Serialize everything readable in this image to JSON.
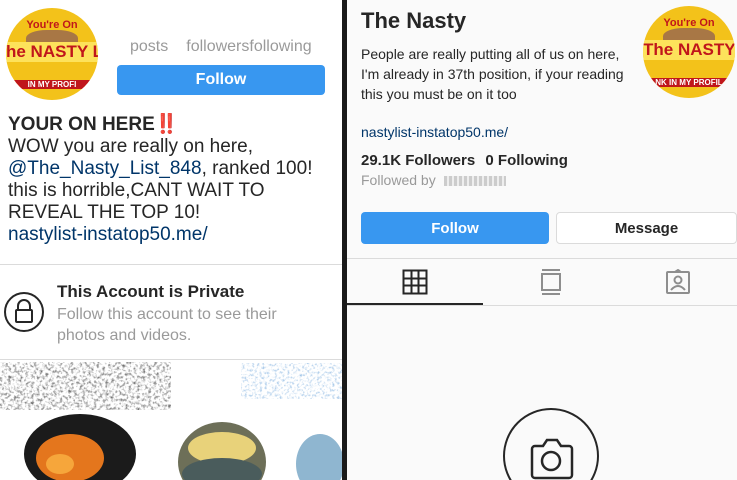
{
  "left": {
    "avatar": {
      "line1": "You're On",
      "line2": "he NASTY Lis",
      "line3": "IN MY PROFI"
    },
    "stats": {
      "posts": "posts",
      "followers": "followers",
      "following": "following"
    },
    "follow_label": "Follow",
    "bio": {
      "name": "YOUR ON HERE",
      "bang": "‼️",
      "line1": "WOW you are really on here,",
      "handle": "@The_Nasty_List_848",
      "line2_rest": ",  ranked 100!",
      "line3": "this is horrible,CANT WAIT TO",
      "line4": "REVEAL THE TOP 10!",
      "link": "nastylist-instatop50.me/"
    },
    "private": {
      "title": "This Account is Private",
      "subtitle": "Follow this account to see their photos and videos."
    }
  },
  "right": {
    "title": "The Nasty",
    "avatar": {
      "line1": "You're On",
      "line2": "The NASTY Lis",
      "line3": "NK IN MY PROFIL"
    },
    "bio": "People are really putting all of us on here, I'm already in 37th position, if your reading this you must be on it too",
    "link": "nastylist-instatop50.me/",
    "followers": "29.1K Followers",
    "following": "0 Following",
    "followed_by": "Followed by",
    "follow_label": "Follow",
    "message_label": "Message"
  },
  "icons": {
    "lock": "lock-icon",
    "grid": "grid-icon",
    "feed": "feed-icon",
    "tagged": "tagged-icon",
    "camera": "camera-icon"
  },
  "colors": {
    "accent": "#3897f0",
    "link": "#003569",
    "badge_yellow": "#f3c21a",
    "badge_red": "#c0161b"
  }
}
